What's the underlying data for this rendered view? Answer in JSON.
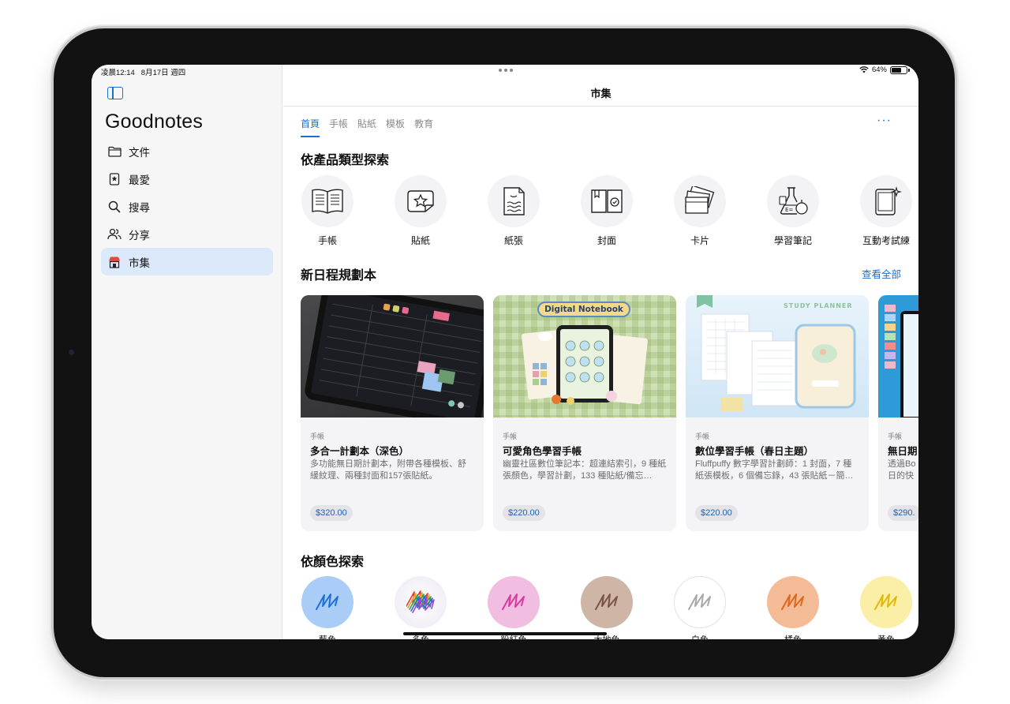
{
  "status_bar": {
    "time": "凌晨12:14",
    "date": "8月17日 週四",
    "battery": "64%",
    "battery_level": 0.64
  },
  "sidebar": {
    "app_name": "Goodnotes",
    "items": [
      {
        "label": "文件",
        "icon": "folder-icon"
      },
      {
        "label": "最愛",
        "icon": "bookmark-star-icon"
      },
      {
        "label": "搜尋",
        "icon": "search-icon"
      },
      {
        "label": "分享",
        "icon": "people-icon"
      },
      {
        "label": "市集",
        "icon": "store-icon",
        "active": true
      }
    ]
  },
  "header": {
    "title": "市集",
    "more": "···"
  },
  "tabs": [
    {
      "label": "首頁",
      "active": true
    },
    {
      "label": "手帳"
    },
    {
      "label": "貼紙"
    },
    {
      "label": "模板"
    },
    {
      "label": "教育"
    }
  ],
  "sections": {
    "categories_title": "依產品類型探索",
    "planners_title": "新日程規劃本",
    "see_all": "查看全部",
    "colors_title": "依顏色探索"
  },
  "categories": [
    {
      "label": "手帳",
      "icon": "open-book-icon"
    },
    {
      "label": "貼紙",
      "icon": "sticker-star-icon"
    },
    {
      "label": "紙張",
      "icon": "paper-icon"
    },
    {
      "label": "封面",
      "icon": "cover-icon"
    },
    {
      "label": "卡片",
      "icon": "cards-icon"
    },
    {
      "label": "學習筆記",
      "icon": "flask-icon"
    },
    {
      "label": "互動考試練",
      "icon": "tablet-sparkle-icon"
    }
  ],
  "cards": [
    {
      "category": "手帳",
      "title": "多合一計劃本（深色）",
      "desc": "多功能無日期計劃本，附帶各種模板、舒緩紋理、兩種封面和157張貼紙。",
      "price": "$320.00"
    },
    {
      "category": "手帳",
      "title": "可愛角色學習手帳",
      "desc": "幽靈社區數位筆記本：超連結索引，9 種紙張顏色，學習計劃，133 種貼紙/備忘…",
      "price": "$220.00",
      "thumb_text": "Digital Notebook"
    },
    {
      "category": "手帳",
      "title": "數位學習手帳（春日主題）",
      "desc": "Fluffpuffy 數字學習計劃師：1 封面，7 種紙張模板，6 個備忘錄，43 張貼紙－簡…",
      "price": "$220.00",
      "thumb_text": "STUDY PLANNER"
    },
    {
      "category": "手帳",
      "title": "無日期",
      "desc": "透過Bo日的快",
      "price": "$290."
    }
  ],
  "colors": [
    {
      "label": "藍色",
      "hex": "#a9cdf6",
      "scribble": "#1f6fd8"
    },
    {
      "label": "多色",
      "hex": "#f2eef6",
      "scribble": "#a040d0"
    },
    {
      "label": "粉紅色",
      "hex": "#f1bde0",
      "scribble": "#d73a9e"
    },
    {
      "label": "大地色",
      "hex": "#cfb5a6",
      "scribble": "#7a5444"
    },
    {
      "label": "白色",
      "hex": "#ffffff",
      "scribble": "#a8a8a8"
    },
    {
      "label": "橘色",
      "hex": "#f4bb97",
      "scribble": "#e0661a"
    },
    {
      "label": "黃色",
      "hex": "#fbeea6",
      "scribble": "#e2b808"
    }
  ],
  "accent_color": "#1a6fd1"
}
